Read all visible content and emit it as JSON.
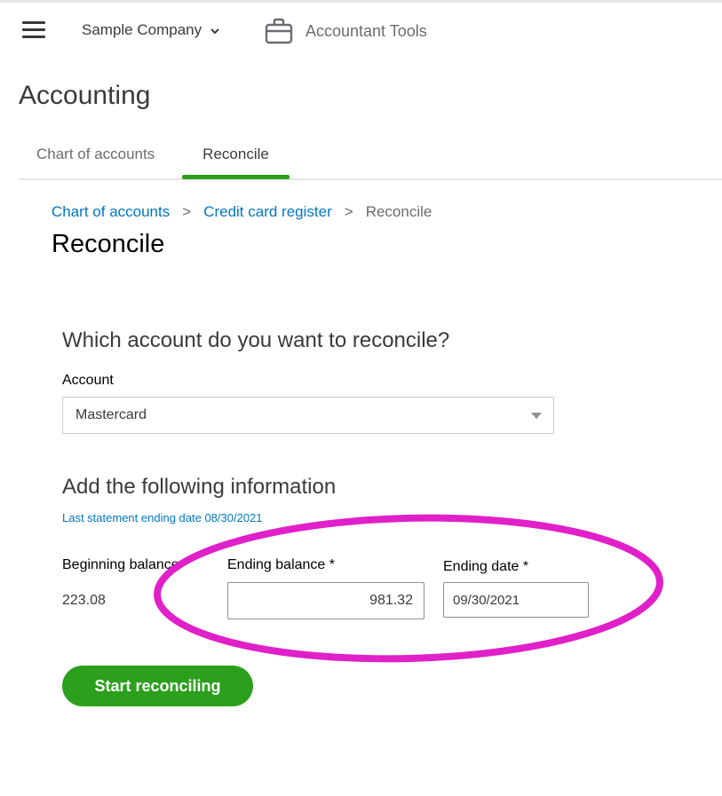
{
  "topbar": {
    "company_name": "Sample Company",
    "accountant_tools": "Accountant Tools"
  },
  "page": {
    "title": "Accounting",
    "tabs": [
      {
        "label": "Chart of accounts",
        "active": false
      },
      {
        "label": "Reconcile",
        "active": true
      }
    ]
  },
  "breadcrumb": {
    "items": [
      "Chart of accounts",
      "Credit card register",
      "Reconcile"
    ],
    "separator": ">"
  },
  "reconcile": {
    "title": "Reconcile",
    "question": "Which account do you want to reconcile?",
    "account_label": "Account",
    "account_value": "Mastercard",
    "info_heading": "Add the following information",
    "last_statement": "Last statement ending date 08/30/2021",
    "beginning_balance_label": "Beginning balance",
    "beginning_balance_value": "223.08",
    "ending_balance_label": "Ending balance *",
    "ending_balance_value": "981.32",
    "ending_date_label": "Ending date *",
    "ending_date_value": "09/30/2021",
    "start_button": "Start reconciling"
  },
  "colors": {
    "brand_green": "#2ca01c",
    "link_blue": "#0077c5",
    "annotation_magenta": "#e020c8"
  },
  "icons": [
    "hamburger-menu-icon",
    "chevron-down-icon",
    "briefcase-icon",
    "dropdown-caret-icon"
  ]
}
